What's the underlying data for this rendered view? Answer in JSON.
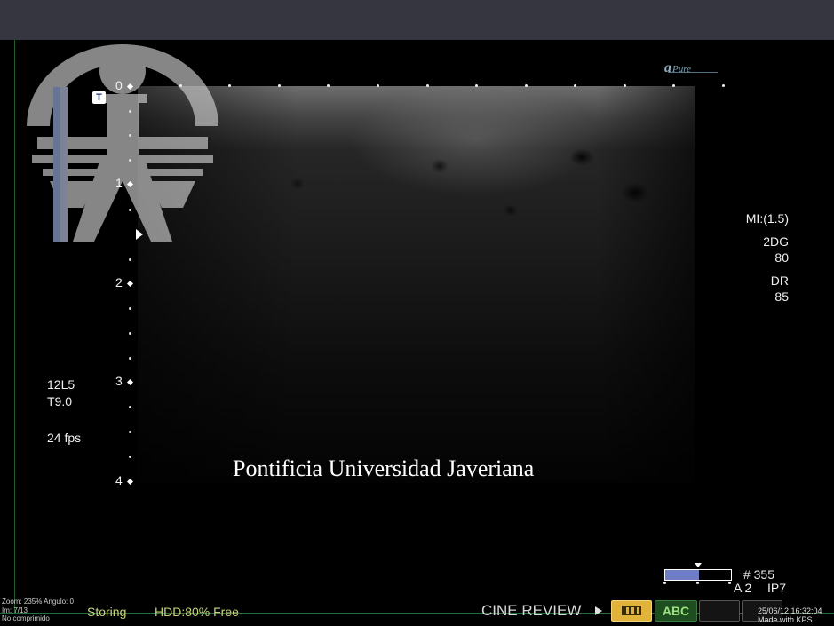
{
  "scanner": {
    "brand_logo": "Pure",
    "probe": "12L5",
    "tissue_preset": "T9.0",
    "frame_rate": "24 fps",
    "mechanical_index": "MI:(1.5)",
    "mode_2d_label": "2DG",
    "mode_2d_gain": "80",
    "dynamic_range_label": "DR",
    "dynamic_range_value": "85",
    "depth_marks": [
      "0",
      "1",
      "2",
      "3",
      "4"
    ],
    "image_number": "# 355",
    "acoustic_power": "A 2",
    "image_processing": "IP7",
    "gray_map_fill_fraction": 0.52
  },
  "watermark_caption": "Pontificia Universidad Javeriana",
  "t_icon_label": "T",
  "status_bar": {
    "zoom_angle": "Zoom: 235% Angulo: 0",
    "image_index": "Im: 7/13",
    "compression": "No comprimido",
    "storing": "Storing",
    "hdd": "HDD:80% Free",
    "cine_review": "CINE REVIEW",
    "abc_button": "ABC",
    "datetime": "25/06/12 16:32:04",
    "made_with": "Made with KPS"
  },
  "colors": {
    "top_bar": "#35363f",
    "status_text": "#c9d47a",
    "gray_bar_fill": "#6f7ec4",
    "film_button": "#e1b33b",
    "abc_button": "#1e4d1f"
  }
}
